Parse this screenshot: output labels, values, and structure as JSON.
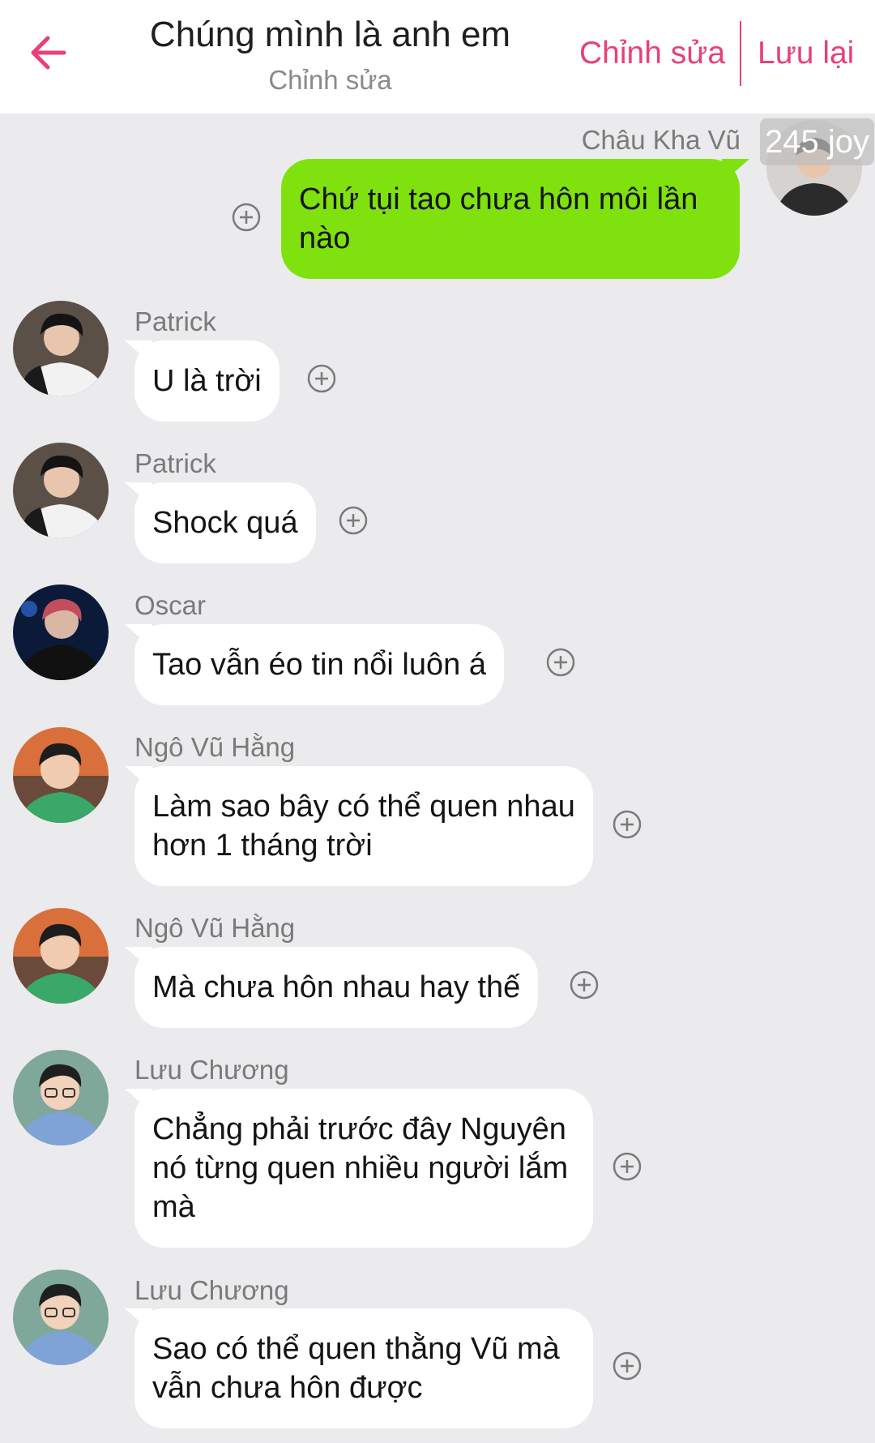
{
  "header": {
    "back_icon": "arrow-left-icon",
    "title": "Chúng mình là anh em",
    "subtitle": "Chỉnh sửa",
    "edit_label": "Chỉnh sửa",
    "save_label": "Lưu lại",
    "accent_color": "#e8407a"
  },
  "watermark": "245 joy",
  "messages": [
    {
      "sender": "Châu Kha Vũ",
      "text": "Chứ tụi tao chưa hôn môi lần nào",
      "outgoing": true
    },
    {
      "sender": "Patrick",
      "text": "U là trời"
    },
    {
      "sender": "Patrick",
      "text": "Shock quá"
    },
    {
      "sender": "Oscar",
      "text": "Tao vẫn éo tin nổi luôn á"
    },
    {
      "sender": "Ngô Vũ Hằng",
      "text": "Làm sao bây có thể quen nhau hơn 1 tháng trời"
    },
    {
      "sender": "Ngô Vũ Hằng",
      "text": "Mà chưa hôn nhau hay thế"
    },
    {
      "sender": "Lưu Chương",
      "text": "Chẳng phải trước đây Nguyên nó từng quen nhiều người lắm mà"
    },
    {
      "sender": "Lưu Chương",
      "text": "Sao có thể quen thằng Vũ mà vẫn chưa hôn được"
    }
  ],
  "colors": {
    "outgoing_bubble": "#7fe20e",
    "incoming_bubble": "#ffffff",
    "background": "#ebebed"
  }
}
